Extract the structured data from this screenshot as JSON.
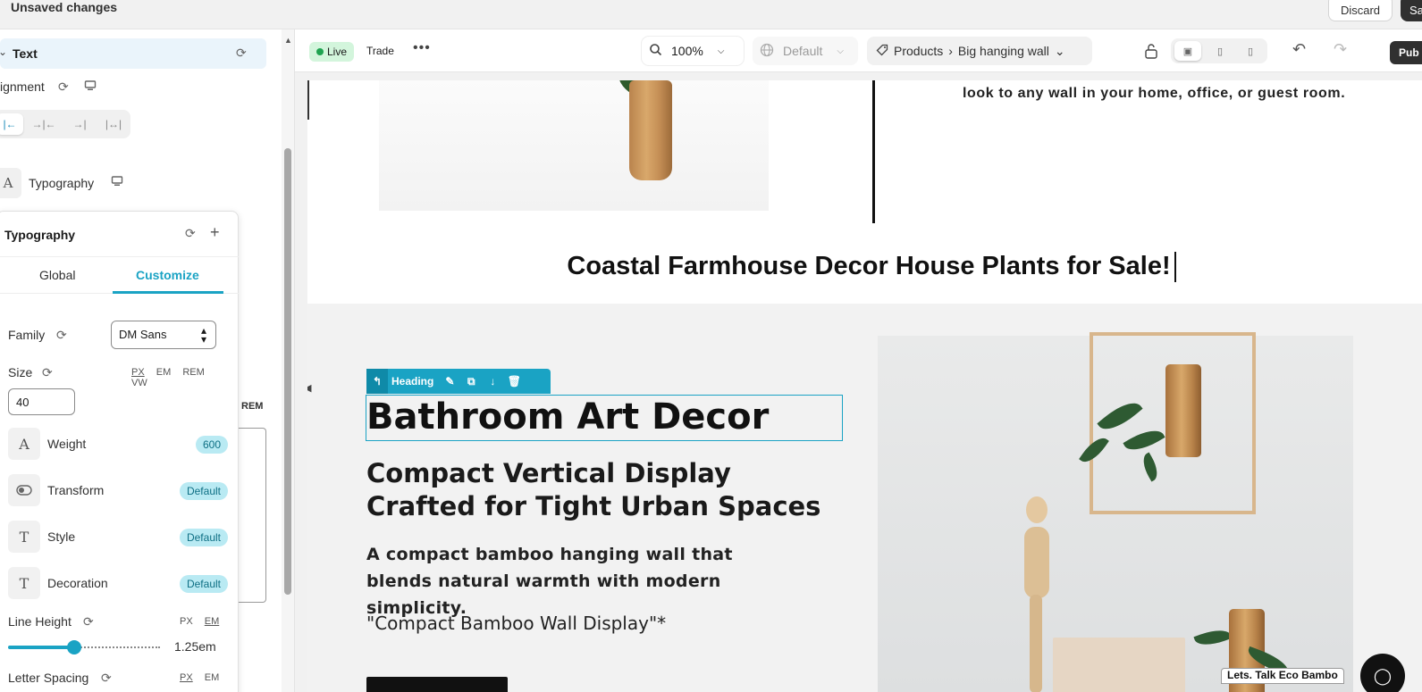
{
  "topbar": {
    "title": "Unsaved changes",
    "discard": "Discard",
    "save": "Sa"
  },
  "left": {
    "text_section": "Text",
    "alignment": "ignment",
    "typography_row": "Typography",
    "card": {
      "title": "Typography",
      "tabs": [
        {
          "label": "Global"
        },
        {
          "label": "Customize",
          "active": true
        }
      ],
      "family": {
        "label": "Family",
        "value": "DM Sans"
      },
      "size": {
        "label": "Size",
        "value": "40",
        "units": [
          "PX",
          "EM",
          "REM",
          "VW"
        ],
        "active_unit": "PX"
      },
      "weight": {
        "label": "Weight",
        "value": "600"
      },
      "transform": {
        "label": "Transform",
        "value": "Default"
      },
      "style": {
        "label": "Style",
        "value": "Default"
      },
      "decoration": {
        "label": "Decoration",
        "value": "Default"
      },
      "line_height": {
        "label": "Line Height",
        "units": [
          "PX",
          "EM"
        ],
        "active_unit": "EM",
        "value": "1.25em"
      },
      "letter_spacing": {
        "label": "Letter Spacing",
        "units": [
          "PX",
          "EM"
        ],
        "active_unit": "PX"
      }
    },
    "rem_label": "REM"
  },
  "toolbar": {
    "live": "Live",
    "trade": "Trade",
    "more": "•••",
    "zoom": "100%",
    "locale": "Default",
    "crumb_section": "Products",
    "crumb_page": "Big hanging wall",
    "publish": "Pub"
  },
  "page": {
    "intro_text": "look to any wall in your home, office, or guest room.",
    "section_heading": "Coastal Farmhouse Decor House Plants for Sale!",
    "heading_tag": "Heading",
    "h1": "Bathroom Art Decor",
    "h2": "Compact Vertical Display Crafted for Tight Urban Spaces",
    "paragraph": "A compact bamboo hanging wall that blends natural warmth with modern simplicity.",
    "quote": "\"Compact Bamboo Wall Display\"*",
    "chat_label": "Lets. Talk Eco Bambo"
  },
  "colors": {
    "accent": "#1aa3c4",
    "live_bg": "#d3f5dc",
    "live_dot": "#1fa350",
    "badge_bg": "#b9eaf3"
  }
}
